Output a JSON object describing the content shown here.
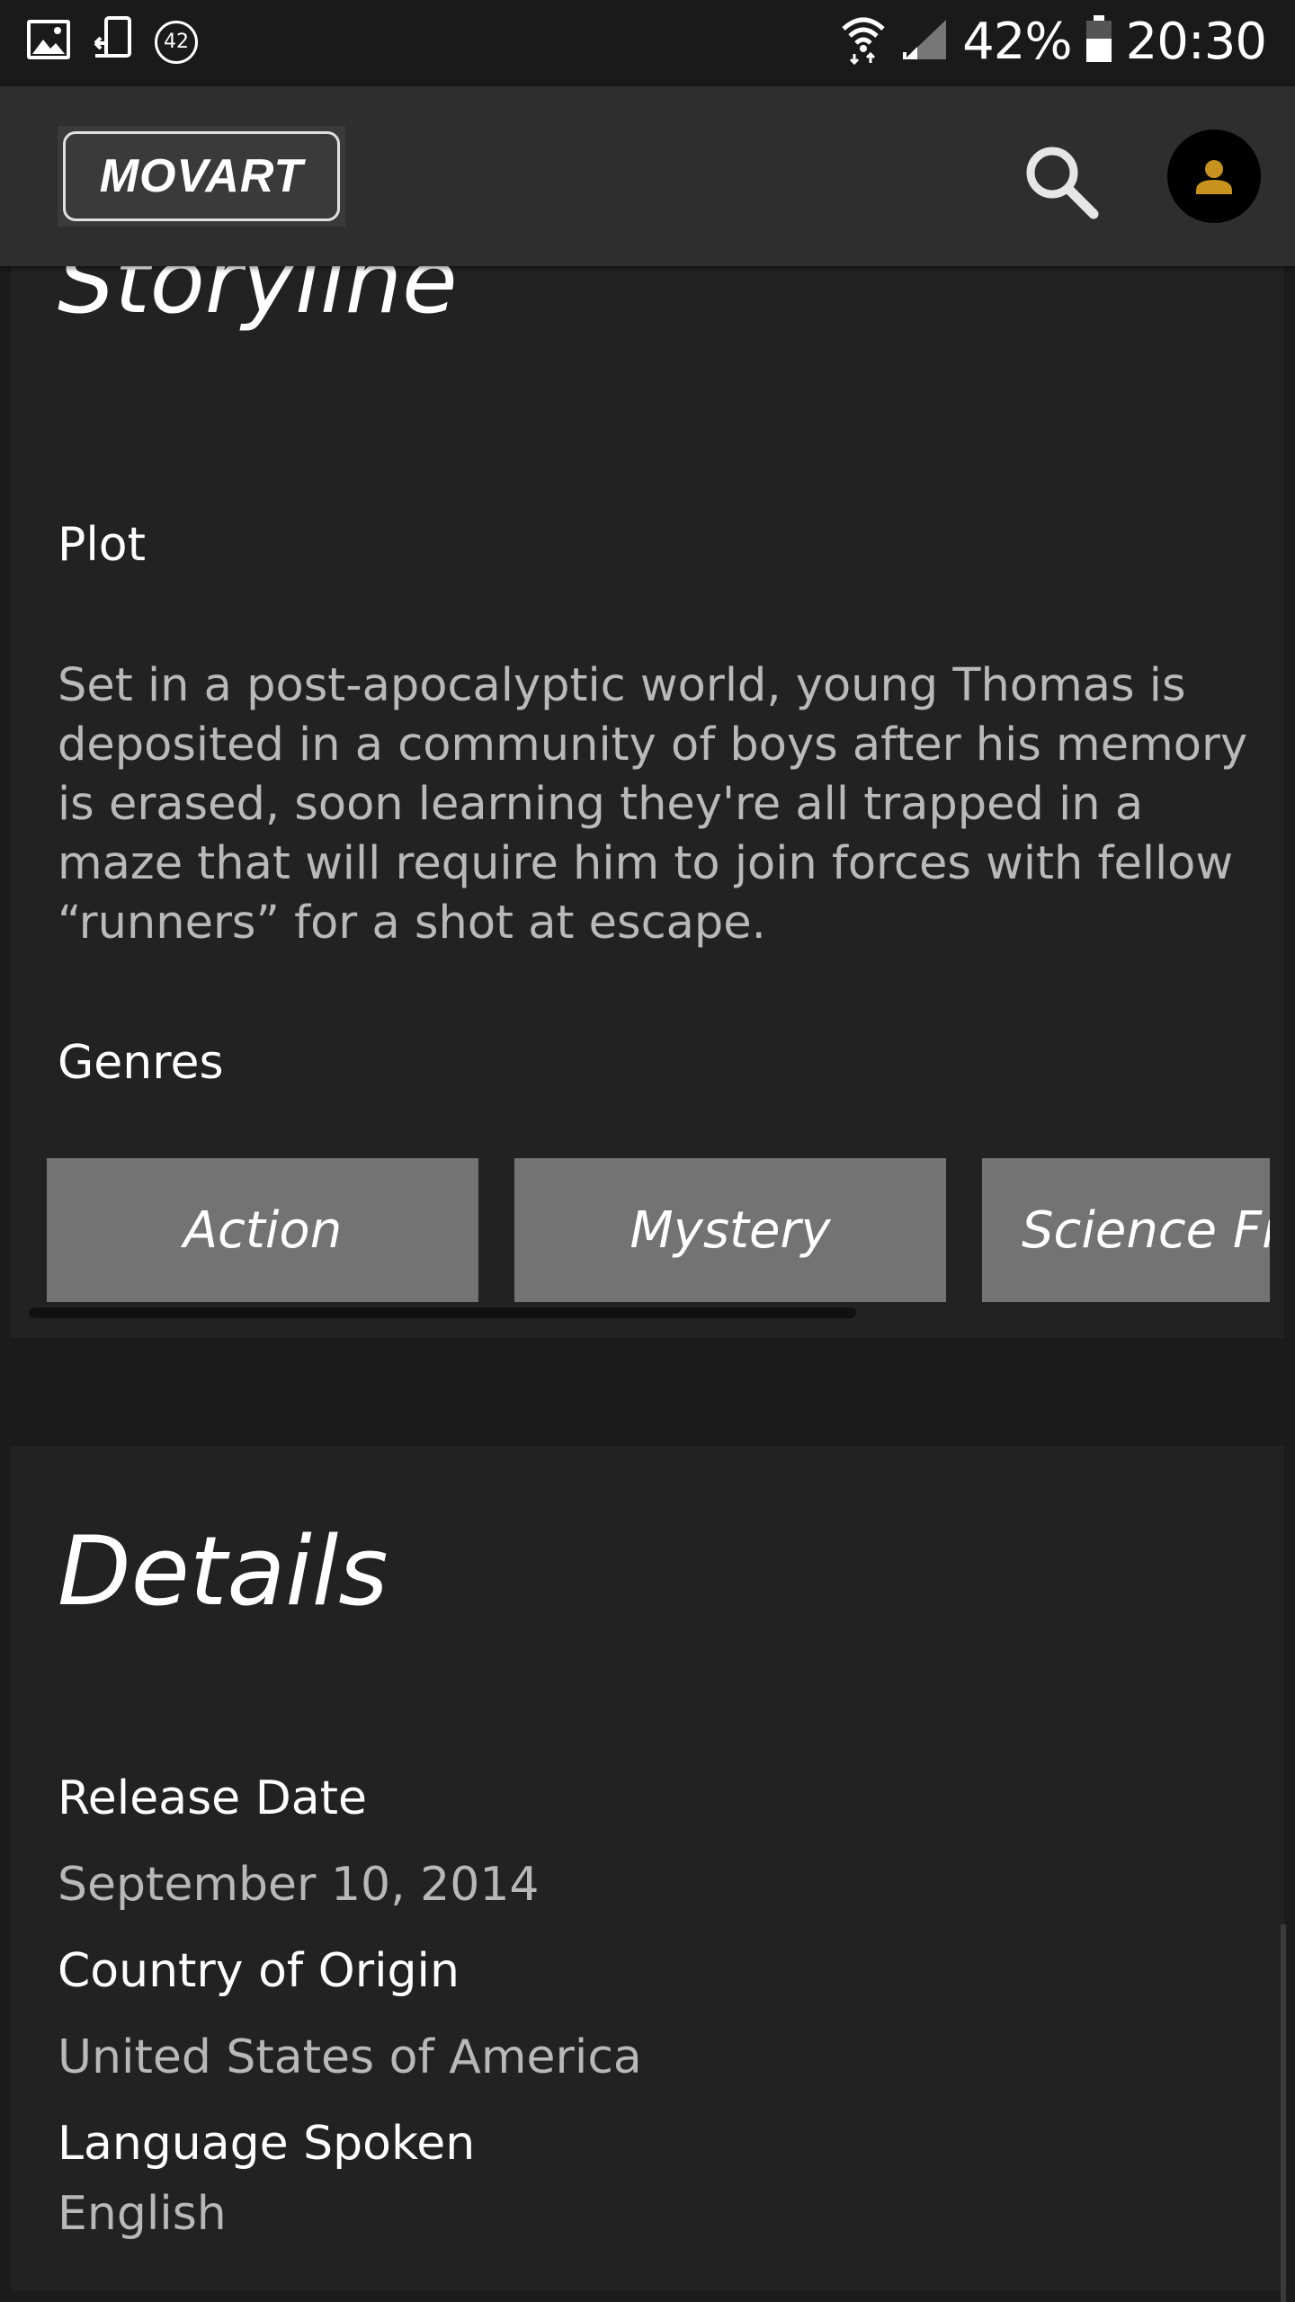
{
  "status_bar": {
    "notification_count": "42",
    "battery": "42%",
    "time": "20:30",
    "icons": [
      "image-icon",
      "phone-sync-icon",
      "wifi-icon",
      "cell-signal-icon",
      "battery-icon"
    ]
  },
  "app_bar": {
    "logo": "MOVART",
    "accent_color": "#c8921e",
    "icons": [
      "search-icon",
      "account-icon"
    ]
  },
  "storyline": {
    "title": "Storyline",
    "plot_label": "Plot",
    "plot_text": "Set in a post-apocalyptic world, young Thomas is deposited in a community of boys after his memory is erased, soon learning they're all trapped in a maze that will require him to join forces with fellow “runners” for a shot at escape.",
    "genres_label": "Genres",
    "genres": [
      "Action",
      "Mystery",
      "Science Fic"
    ]
  },
  "details": {
    "title": "Details",
    "release_date_label": "Release Date",
    "release_date": "September 10, 2014",
    "country_label": "Country of Origin",
    "country": "United States of America",
    "language_label": "Language Spoken",
    "language": "English"
  }
}
